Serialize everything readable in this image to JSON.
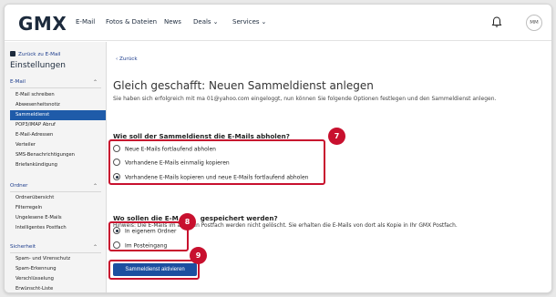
{
  "nav": {
    "logo": "GMX",
    "links": [
      "E-Mail",
      "Fotos & Dateien",
      "News",
      "Deals",
      "Services"
    ],
    "avatar_initials": "MM"
  },
  "sidebar": {
    "back_label": "Zurück zu E-Mail",
    "title": "Einstellungen",
    "sections": [
      {
        "label": "E-Mail",
        "items": [
          "E-Mail schreiben",
          "Abwesenheitsnotiz",
          "Sammeldienst",
          "POP3/IMAP Abruf",
          "E-Mail-Adressen",
          "Verteiler",
          "SMS-Benachrichtigungen",
          "Briefankündigung"
        ]
      },
      {
        "label": "Ordner",
        "items": [
          "Ordnerübersicht",
          "Filterregeln",
          "Ungelesene E-Mails",
          "Intelligentes Postfach"
        ]
      },
      {
        "label": "Sicherheit",
        "items": [
          "Spam- und Virenschutz",
          "Spam-Erkennung",
          "Verschlüsselung",
          "Erwünscht-Liste"
        ]
      }
    ],
    "active_item": "Sammeldienst"
  },
  "main": {
    "back_label": "Zurück",
    "headline": "Gleich geschafft: Neuen Sammeldienst anlegen",
    "intro": "Sie haben sich erfolgreich mit ma                01@yahoo.com eingeloggt, nun können Sie folgende Optionen festlegen und den Sammeldienst anlegen.",
    "q1": {
      "title": "Wie soll der Sammeldienst die E-Mails abholen?",
      "options": [
        "Neue E-Mails fortlaufend abholen",
        "Vorhandene E-Mails einmalig kopieren",
        "Vorhandene E-Mails kopieren und neue E-Mails fortlaufend abholen"
      ],
      "selected": 2
    },
    "hint": "Hinweis: Die E-Mails im anderen Postfach werden nicht gelöscht. Sie erhalten die E-Mails von dort als Kopie in Ihr GMX Postfach.",
    "q2": {
      "title_part1": "Wo sollen die E-M",
      "title_part2": "gespeichert werden?",
      "options": [
        "In eigenem Ordner",
        "Im Posteingang"
      ],
      "selected": 0
    },
    "activate_button": "Sammeldienst aktivieren"
  },
  "badges": [
    "7",
    "8",
    "9"
  ],
  "colors": {
    "highlight": "#c8102e",
    "brand_navy": "#1c2a3c",
    "active_blue": "#1f5ba9",
    "button_blue": "#1c4fa0"
  }
}
